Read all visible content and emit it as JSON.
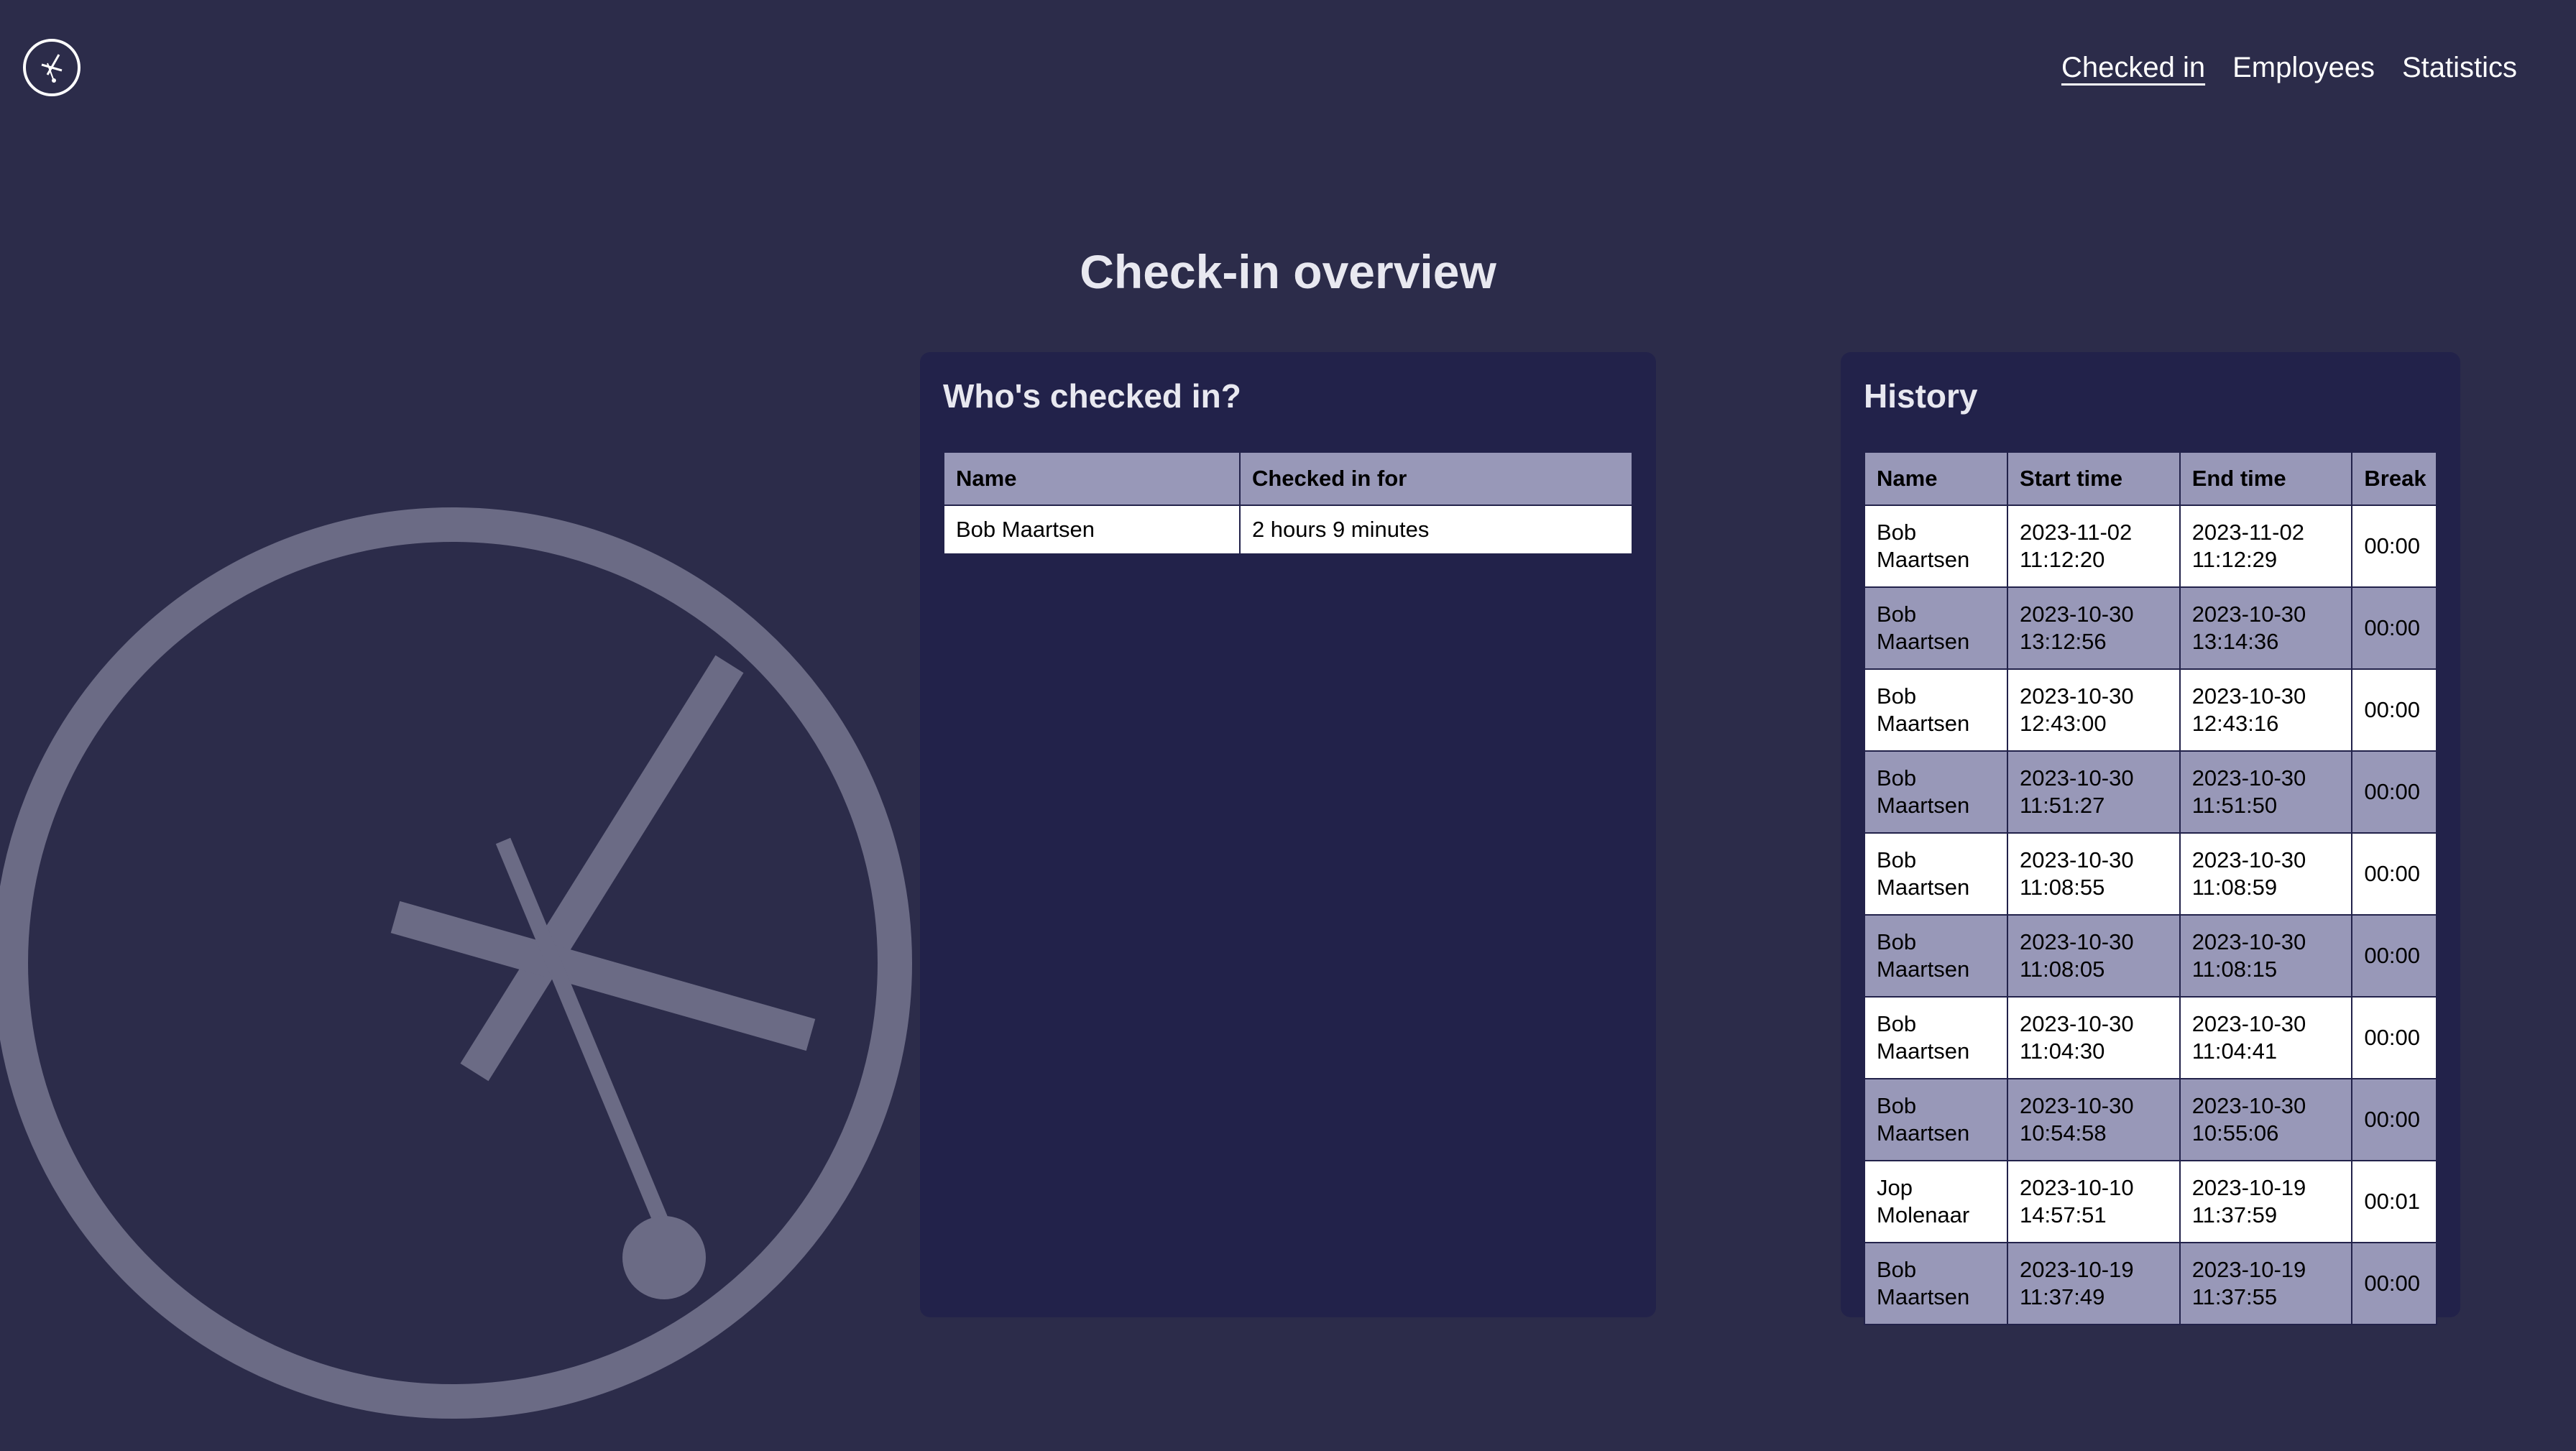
{
  "nav": {
    "items": [
      {
        "label": "Checked in",
        "active": true
      },
      {
        "label": "Employees",
        "active": false
      },
      {
        "label": "Statistics",
        "active": false
      }
    ]
  },
  "icons": {
    "logo": "clock-icon",
    "background": "clock-illustration"
  },
  "colors": {
    "background": "#2c2c4a",
    "panel": "#22224a",
    "table_header": "#9898b8",
    "table_row_alt": "#9898b8",
    "table_row": "#ffffff",
    "illustration": "#6b6b85"
  },
  "page": {
    "title": "Check-in overview"
  },
  "checked_in": {
    "title": "Who's checked in?",
    "columns": [
      "Name",
      "Checked in for"
    ],
    "rows": [
      {
        "name": "Bob Maartsen",
        "duration": "2 hours 9 minutes"
      }
    ]
  },
  "history": {
    "title": "History",
    "columns": [
      "Name",
      "Start time",
      "End time",
      "Break"
    ],
    "rows": [
      {
        "first": "Bob",
        "last": "Maartsen",
        "start_date": "2023-11-02",
        "start_time": "11:12:20",
        "end_date": "2023-11-02",
        "end_time": "11:12:29",
        "break": "00:00"
      },
      {
        "first": "Bob",
        "last": "Maartsen",
        "start_date": "2023-10-30",
        "start_time": "13:12:56",
        "end_date": "2023-10-30",
        "end_time": "13:14:36",
        "break": "00:00"
      },
      {
        "first": "Bob",
        "last": "Maartsen",
        "start_date": "2023-10-30",
        "start_time": "12:43:00",
        "end_date": "2023-10-30",
        "end_time": "12:43:16",
        "break": "00:00"
      },
      {
        "first": "Bob",
        "last": "Maartsen",
        "start_date": "2023-10-30",
        "start_time": "11:51:27",
        "end_date": "2023-10-30",
        "end_time": "11:51:50",
        "break": "00:00"
      },
      {
        "first": "Bob",
        "last": "Maartsen",
        "start_date": "2023-10-30",
        "start_time": "11:08:55",
        "end_date": "2023-10-30",
        "end_time": "11:08:59",
        "break": "00:00"
      },
      {
        "first": "Bob",
        "last": "Maartsen",
        "start_date": "2023-10-30",
        "start_time": "11:08:05",
        "end_date": "2023-10-30",
        "end_time": "11:08:15",
        "break": "00:00"
      },
      {
        "first": "Bob",
        "last": "Maartsen",
        "start_date": "2023-10-30",
        "start_time": "11:04:30",
        "end_date": "2023-10-30",
        "end_time": "11:04:41",
        "break": "00:00"
      },
      {
        "first": "Bob",
        "last": "Maartsen",
        "start_date": "2023-10-30",
        "start_time": "10:54:58",
        "end_date": "2023-10-30",
        "end_time": "10:55:06",
        "break": "00:00"
      },
      {
        "first": "Jop",
        "last": "Molenaar",
        "start_date": "2023-10-10",
        "start_time": "14:57:51",
        "end_date": "2023-10-19",
        "end_time": "11:37:59",
        "break": "00:01"
      },
      {
        "first": "Bob",
        "last": "Maartsen",
        "start_date": "2023-10-19",
        "start_time": "11:37:49",
        "end_date": "2023-10-19",
        "end_time": "11:37:55",
        "break": "00:00"
      }
    ]
  }
}
